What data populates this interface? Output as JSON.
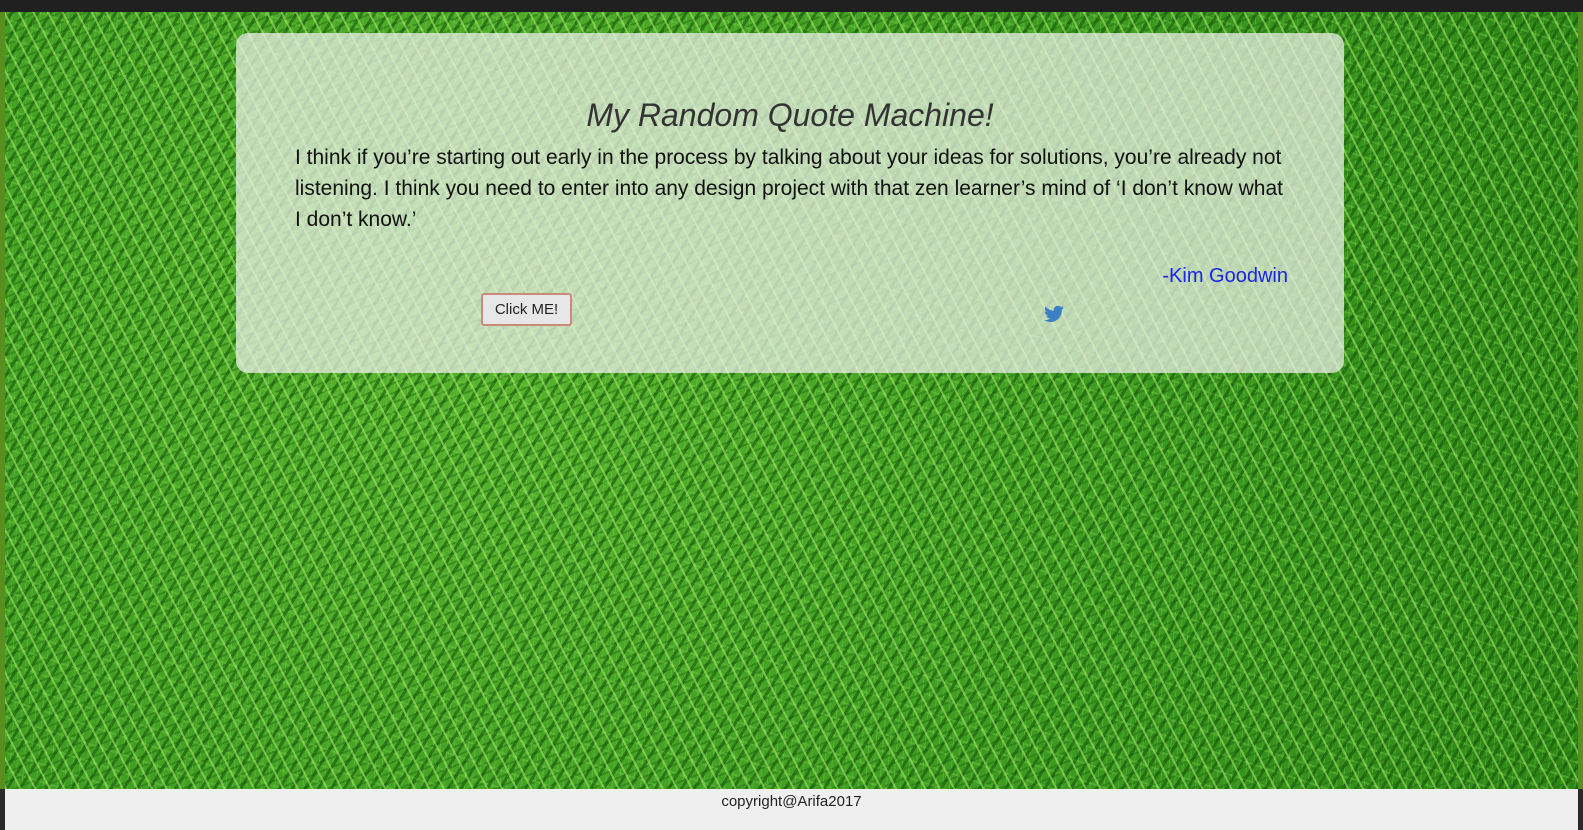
{
  "page": {
    "title": "My Random Quote Machine!"
  },
  "quote": {
    "text": "I think if you’re starting out early in the process by talking about your ideas for solutions, you’re already not listening. I think you need to enter into any design project with that zen learner’s mind of ‘I don’t know what I don’t know.’",
    "author": "-Kim Goodwin"
  },
  "actions": {
    "new_quote_label": "Click ME!",
    "tweet_icon": "twitter-icon"
  },
  "footer": {
    "copyright": "copyright@Arifa2017"
  },
  "colors": {
    "author_link": "#1a23e6",
    "twitter_blue": "#3b7fc4",
    "card_background": "rgba(236,240,232,0.74)"
  }
}
